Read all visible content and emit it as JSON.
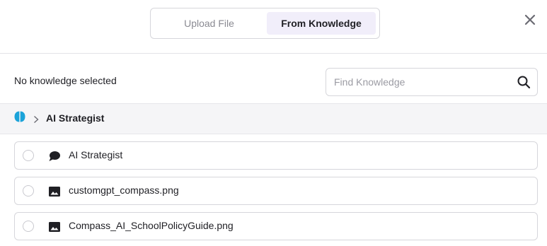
{
  "tabs": [
    {
      "label": "Upload File",
      "active": false
    },
    {
      "label": "From Knowledge",
      "active": true
    }
  ],
  "close_icon": "close-icon",
  "selection_status": "No knowledge selected",
  "search": {
    "placeholder": "Find Knowledge",
    "value": "",
    "icon": "search-icon"
  },
  "breadcrumb": {
    "root_icon": "brain-icon",
    "separator_icon": "chevron-right-icon",
    "current": "AI Strategist"
  },
  "items": [
    {
      "name": "AI Strategist",
      "icon": "chat-bubble-icon",
      "selected": false
    },
    {
      "name": "customgpt_compass.png",
      "icon": "image-icon",
      "selected": false
    },
    {
      "name": "Compass_AI_SchoolPolicyGuide.png",
      "icon": "image-icon",
      "selected": false
    }
  ],
  "colors": {
    "active_tab_bg": "#f1eefa",
    "brain_icon": "#1ba3d9",
    "border": "#d6d6db"
  }
}
